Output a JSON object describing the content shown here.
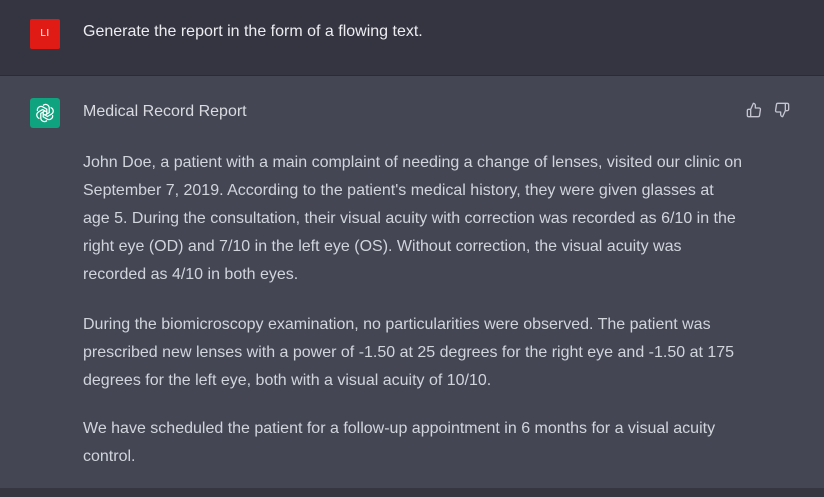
{
  "user_message": {
    "avatar_initials": "LI",
    "avatar_color": "#e01b15",
    "text": "Generate the report in the form of a flowing text."
  },
  "assistant_message": {
    "avatar_icon": "openai-logo-icon",
    "avatar_color": "#10a37f",
    "title": "Medical Record Report",
    "paragraphs": [
      "John Doe, a patient with a main complaint of needing a change of lenses, visited our clinic on September 7, 2019. According to the patient's medical history, they were given glasses at age 5. During the consultation, their visual acuity with correction was recorded as 6/10 in the right eye (OD) and 7/10 in the left eye (OS). Without correction, the visual acuity was recorded as 4/10 in both eyes.",
      "During the biomicroscopy examination, no particularities were observed. The patient was prescribed new lenses with a power of -1.50 at 25 degrees for the right eye and -1.50 at 175 degrees for the left eye, both with a visual acuity of 10/10.",
      "We have scheduled the patient for a follow-up appointment in 6 months for a visual acuity control."
    ],
    "actions": [
      "thumbs-up-icon",
      "thumbs-down-icon"
    ]
  },
  "colors": {
    "background": "#343541",
    "assistant_background": "#444654",
    "text": "#d1d5db"
  }
}
